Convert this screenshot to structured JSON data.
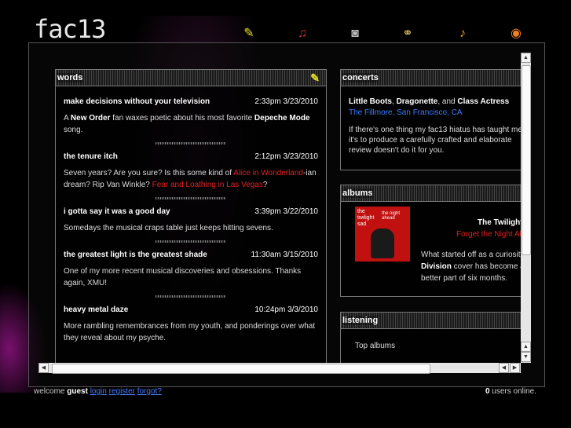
{
  "logo": "fac13",
  "nav": [
    {
      "icon": "pencil-icon",
      "glyph": "✎",
      "color": "#e8e020"
    },
    {
      "icon": "music-note-icon",
      "glyph": "♫",
      "color": "#e02a2a"
    },
    {
      "icon": "camera-icon",
      "glyph": "◙",
      "color": "#bbbbbb"
    },
    {
      "icon": "chain-link-icon",
      "glyph": "⚭",
      "color": "#e0c060"
    },
    {
      "icon": "bells-icon",
      "glyph": "♪",
      "color": "#e0a020"
    },
    {
      "icon": "rss-icon",
      "glyph": "◉",
      "color": "#f08020"
    }
  ],
  "words": {
    "title": "words",
    "posts": [
      {
        "title": "make decisions without your television",
        "time": "2:33pm 3/23/2010",
        "body": [
          "A ",
          "New Order",
          " fan waxes poetic about his most favorite ",
          "Depeche Mode",
          " song."
        ]
      },
      {
        "title": "the tenure itch",
        "time": "2:12pm 3/23/2010",
        "body": [
          "Seven years? Are you sure? Is this some kind of ",
          "Alice in Wonderland",
          "-ian dream? Rip Van Winkle? ",
          "Fear and Loathing in Las Vegas",
          "?"
        ]
      },
      {
        "title": "i gotta say it was a good day",
        "time": "3:39pm 3/22/2010",
        "body": "Somedays the musical craps table just keeps hitting sevens."
      },
      {
        "title": "the greatest light is the greatest shade",
        "time": "11:30am 3/15/2010",
        "body": "One of my more recent musical discoveries and obsessions. Thanks again, XMU!"
      },
      {
        "title": "heavy metal daze",
        "time": "10:24pm 3/3/2010",
        "body": "More rambling remembrances from my youth, and ponderings over what they reveal about my psyche."
      }
    ]
  },
  "concerts": {
    "title": "concerts",
    "band1": "Little Boots",
    "sep1": ", ",
    "band2": "Dragonette",
    "sep2": ", and ",
    "band3": "Class Actress",
    "venue": "The Fillmore, San Francisco, CA",
    "body": "If there's one thing my fac13 hiatus has taught me, it's to produce a carefully crafted and elaborate review doesn't do it for you."
  },
  "albums": {
    "title": "albums",
    "artist": "The Twilight Sad",
    "album": "Forget the Night Ahead",
    "art_text": "the twilight sad",
    "art_text2": "the night ahead",
    "body_a": "What started off as a curiosity",
    "body_b": "Division",
    "body_c": " cover has become a better part of six months."
  },
  "listening": {
    "title": "listening",
    "item": "Top albums"
  },
  "footer": {
    "welcome": "welcome ",
    "guest": "guest",
    "login": "login",
    "register": "register",
    "forgot": "forgot?",
    "users_count": "0",
    "users_label": " users online."
  }
}
